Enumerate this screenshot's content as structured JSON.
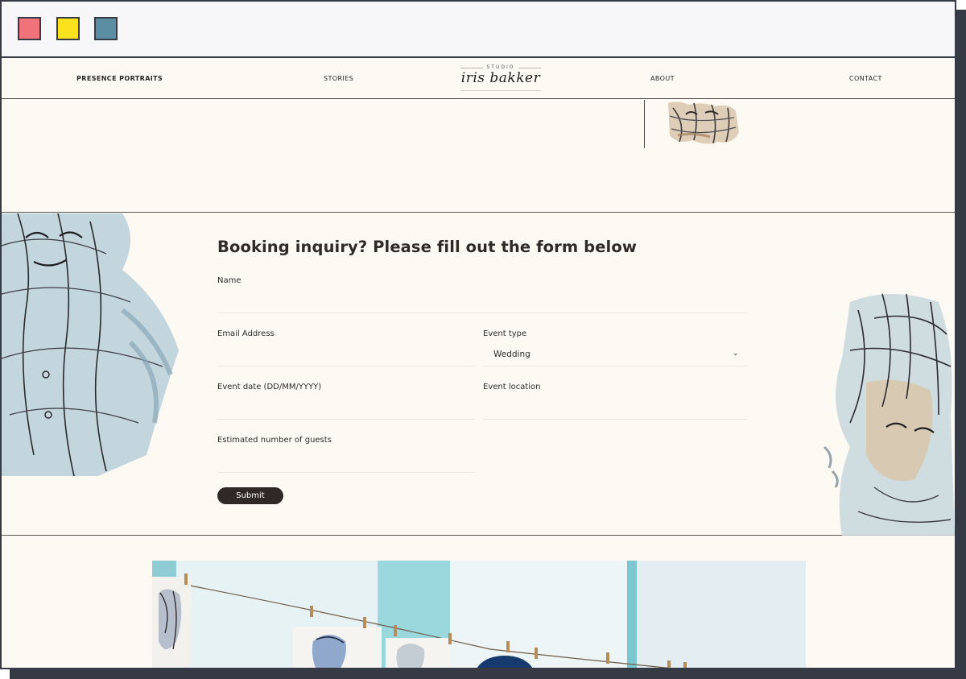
{
  "nav": {
    "presence": "PRESENCE PORTRAITS",
    "stories": "STORIES",
    "about": "ABOUT",
    "contact": "CONTACT",
    "logo_top": "STUDIO",
    "logo_main": "iris bakker"
  },
  "form": {
    "title": "Booking inquiry? Please fill out the form below",
    "name_label": "Name",
    "email_label": "Email Address",
    "event_type_label": "Event type",
    "event_type_value": "Wedding",
    "event_date_label": "Event date (DD/MM/YYYY)",
    "event_location_label": "Event location",
    "guests_label": "Estimated number of guests",
    "submit": "Submit"
  },
  "colors": {
    "background": "#fdfaf4",
    "frame": "#363a45",
    "text": "#2f2a27",
    "button": "#2f2825",
    "dot_red": "#f0727b",
    "dot_yellow": "#fce21d",
    "dot_blue": "#5b8ea2"
  }
}
